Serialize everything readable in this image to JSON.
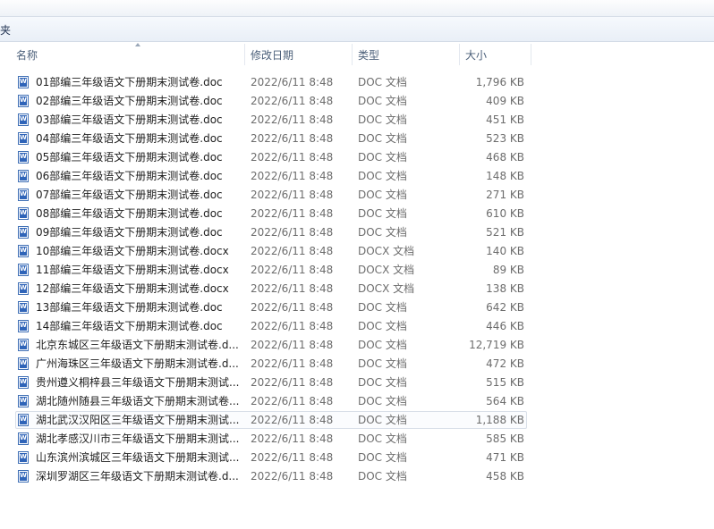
{
  "toolbar": {
    "label": "夹"
  },
  "columns": {
    "name": "名称",
    "date": "修改日期",
    "type": "类型",
    "size": "大小"
  },
  "files": [
    {
      "name": "01部编三年级语文下册期末测试卷.doc",
      "date": "2022/6/11 8:48",
      "type": "DOC 文档",
      "size": "1,796 KB"
    },
    {
      "name": "02部编三年级语文下册期末测试卷.doc",
      "date": "2022/6/11 8:48",
      "type": "DOC 文档",
      "size": "409 KB"
    },
    {
      "name": "03部编三年级语文下册期末测试卷.doc",
      "date": "2022/6/11 8:48",
      "type": "DOC 文档",
      "size": "451 KB"
    },
    {
      "name": "04部编三年级语文下册期末测试卷.doc",
      "date": "2022/6/11 8:48",
      "type": "DOC 文档",
      "size": "523 KB"
    },
    {
      "name": "05部编三年级语文下册期末测试卷.doc",
      "date": "2022/6/11 8:48",
      "type": "DOC 文档",
      "size": "468 KB"
    },
    {
      "name": "06部编三年级语文下册期末测试卷.doc",
      "date": "2022/6/11 8:48",
      "type": "DOC 文档",
      "size": "148 KB"
    },
    {
      "name": "07部编三年级语文下册期末测试卷.doc",
      "date": "2022/6/11 8:48",
      "type": "DOC 文档",
      "size": "271 KB"
    },
    {
      "name": "08部编三年级语文下册期末测试卷.doc",
      "date": "2022/6/11 8:48",
      "type": "DOC 文档",
      "size": "610 KB"
    },
    {
      "name": "09部编三年级语文下册期末测试卷.doc",
      "date": "2022/6/11 8:48",
      "type": "DOC 文档",
      "size": "521 KB"
    },
    {
      "name": "10部编三年级语文下册期末测试卷.docx",
      "date": "2022/6/11 8:48",
      "type": "DOCX 文档",
      "size": "140 KB"
    },
    {
      "name": "11部编三年级语文下册期末测试卷.docx",
      "date": "2022/6/11 8:48",
      "type": "DOCX 文档",
      "size": "89 KB"
    },
    {
      "name": "12部编三年级语文下册期末测试卷.docx",
      "date": "2022/6/11 8:48",
      "type": "DOCX 文档",
      "size": "138 KB"
    },
    {
      "name": "13部编三年级语文下册期末测试卷.doc",
      "date": "2022/6/11 8:48",
      "type": "DOC 文档",
      "size": "642 KB"
    },
    {
      "name": "14部编三年级语文下册期末测试卷.doc",
      "date": "2022/6/11 8:48",
      "type": "DOC 文档",
      "size": "446 KB"
    },
    {
      "name": "北京东城区三年级语文下册期末测试卷.d...",
      "date": "2022/6/11 8:48",
      "type": "DOC 文档",
      "size": "12,719 KB"
    },
    {
      "name": "广州海珠区三年级语文下册期末测试卷.d...",
      "date": "2022/6/11 8:48",
      "type": "DOC 文档",
      "size": "472 KB"
    },
    {
      "name": "贵州遵义桐梓县三年级语文下册期末测试...",
      "date": "2022/6/11 8:48",
      "type": "DOC 文档",
      "size": "515 KB"
    },
    {
      "name": "湖北随州随县三年级语文下册期末测试卷...",
      "date": "2022/6/11 8:48",
      "type": "DOC 文档",
      "size": "564 KB"
    },
    {
      "name": "湖北武汉汉阳区三年级语文下册期末测试...",
      "date": "2022/6/11 8:48",
      "type": "DOC 文档",
      "size": "1,188 KB",
      "selected": true
    },
    {
      "name": "湖北孝感汉川市三年级语文下册期末测试...",
      "date": "2022/6/11 8:48",
      "type": "DOC 文档",
      "size": "585 KB"
    },
    {
      "name": "山东滨州滨城区三年级语文下册期末测试...",
      "date": "2022/6/11 8:48",
      "type": "DOC 文档",
      "size": "471 KB"
    },
    {
      "name": "深圳罗湖区三年级语文下册期末测试卷.d...",
      "date": "2022/6/11 8:48",
      "type": "DOC 文档",
      "size": "458 KB"
    }
  ]
}
